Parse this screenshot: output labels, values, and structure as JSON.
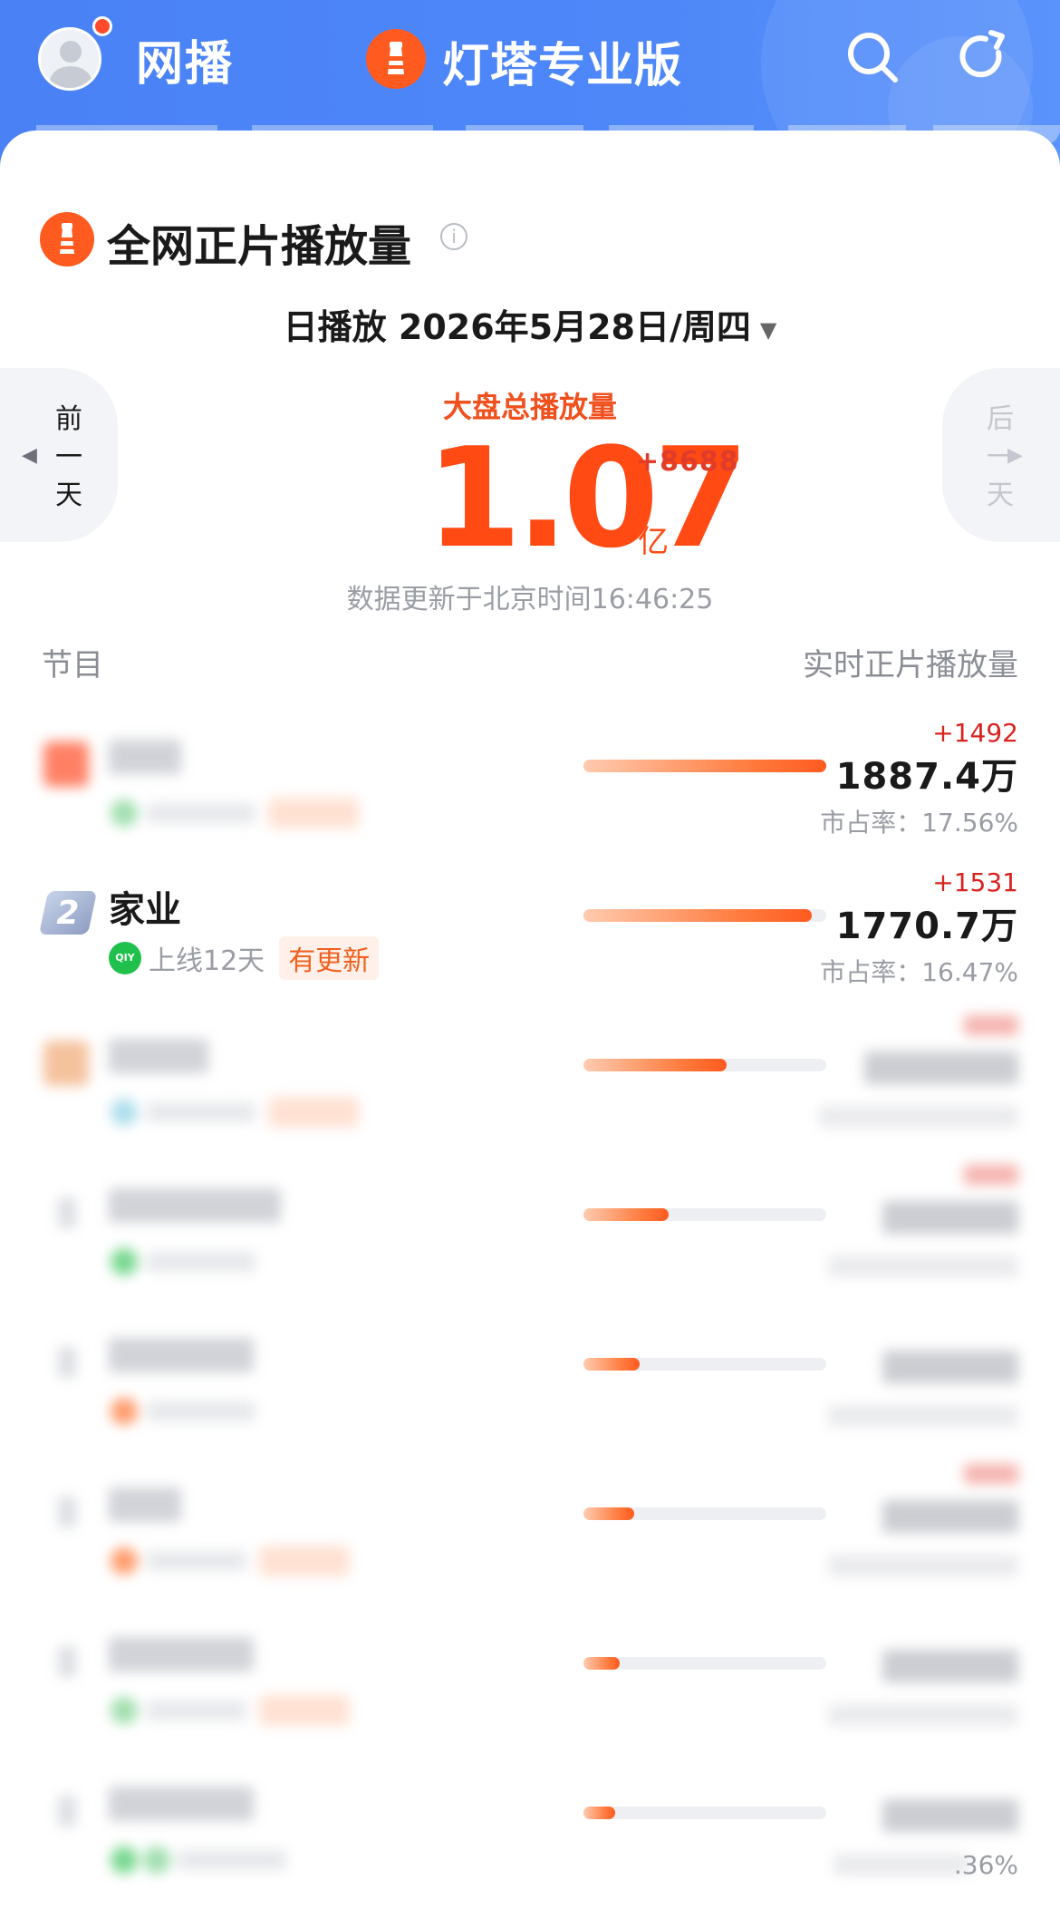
{
  "header": {
    "title": "网播",
    "brand": "灯塔专业版",
    "icons": [
      "avatar-icon",
      "search-icon",
      "refresh-icon"
    ]
  },
  "section": {
    "title": "全网正片播放量",
    "date_label": "日播放",
    "date": "2026年5月28日/周四",
    "prev_day": [
      "前",
      "一",
      "天"
    ],
    "next_day": [
      "后",
      "一",
      "天"
    ]
  },
  "total": {
    "label": "大盘总播放量",
    "value": "1.07",
    "unit": "亿",
    "delta": "+8688",
    "update_time": "数据更新于北京时间16:46:25"
  },
  "columns": {
    "left": "节目",
    "right": "实时正片播放量"
  },
  "rows": [
    {
      "rank": "1",
      "name": "",
      "days": "",
      "badge": "",
      "delta": "+1492",
      "value": "1887.4万",
      "share": "市占率：17.56%",
      "bar": 1.0,
      "blurred": true
    },
    {
      "rank": "2",
      "name": "家业",
      "platform": "QIY",
      "days": "上线12天",
      "badge": "有更新",
      "delta": "+1531",
      "value": "1770.7万",
      "share": "市占率：16.47%",
      "bar": 0.94,
      "blurred": false
    },
    {
      "rank": "3",
      "bar": 0.59,
      "blurred": true
    },
    {
      "rank": "4",
      "bar": 0.35,
      "blurred": true
    },
    {
      "rank": "5",
      "bar": 0.23,
      "blurred": true
    },
    {
      "rank": "6",
      "bar": 0.21,
      "blurred": true
    },
    {
      "rank": "7",
      "bar": 0.15,
      "blurred": true
    },
    {
      "rank": "8",
      "share_tail": ".36%",
      "bar": 0.13,
      "blurred": true
    }
  ],
  "colors": {
    "header_blue": "#4a82f6",
    "accent_orange": "#ff4a14",
    "delta_red": "#d8231f"
  }
}
